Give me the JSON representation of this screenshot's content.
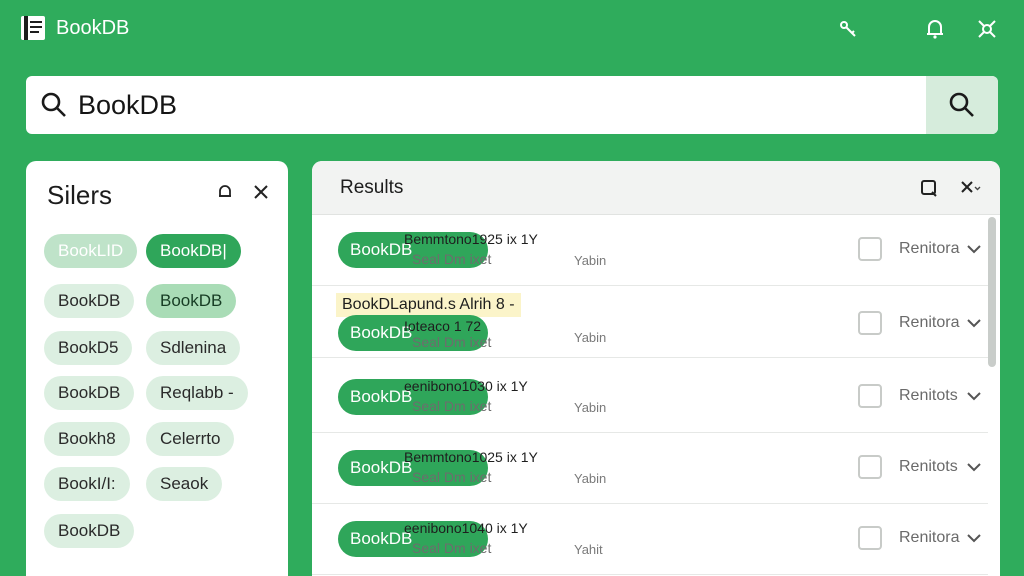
{
  "app": {
    "title": "BookDB"
  },
  "header": {
    "icons": [
      "key-icon",
      "bell-icon",
      "settings-icon"
    ]
  },
  "search": {
    "value": "BookDB",
    "placeholder": ""
  },
  "filters": {
    "title": "Silers",
    "chips": [
      "BookLID",
      "BookDB|",
      "BookDB",
      "BookDB",
      "BookD5",
      "Sdlenina",
      "BookDB",
      "Reqlabb -",
      "Bookh8",
      "Celerrto",
      "BookI/I:",
      "Seaok",
      "BookDB"
    ]
  },
  "results": {
    "title": "Results",
    "rows": [
      {
        "pill": "BookDB",
        "meta1": "Bemmtono1925  ix  1Y",
        "meta2": "Seal Dm  ixet",
        "meta3": "Yabin",
        "status": "Renitora",
        "highlight": ""
      },
      {
        "pill": "BookDB",
        "meta1": "Ioteaco 1 72",
        "meta2": "Seal Dm  ixet",
        "meta3": "Yabin",
        "status": "Renitora",
        "highlight": "BookDLapund.s Alrih 8 -"
      },
      {
        "pill": "BookDB",
        "meta1": "eenibono1030  ix  1Y",
        "meta2": "Seal Dm  ixet",
        "meta3": "Yabin",
        "status": "Renitots",
        "highlight": ""
      },
      {
        "pill": "BookDB",
        "meta1": "Bemmtono1025  ix  1Y",
        "meta2": "Seal Dm  ixet",
        "meta3": "Yabin",
        "status": "Renitots",
        "highlight": ""
      },
      {
        "pill": "BookDB",
        "meta1": "eenibono1040  ix  1Y",
        "meta2": "Seal Dm  ixet",
        "meta3": "Yahit",
        "status": "Renitora",
        "highlight": ""
      }
    ]
  },
  "colors": {
    "brand": "#2fac5c",
    "accent": "#2fa65a",
    "chip": "#dcefe1"
  }
}
